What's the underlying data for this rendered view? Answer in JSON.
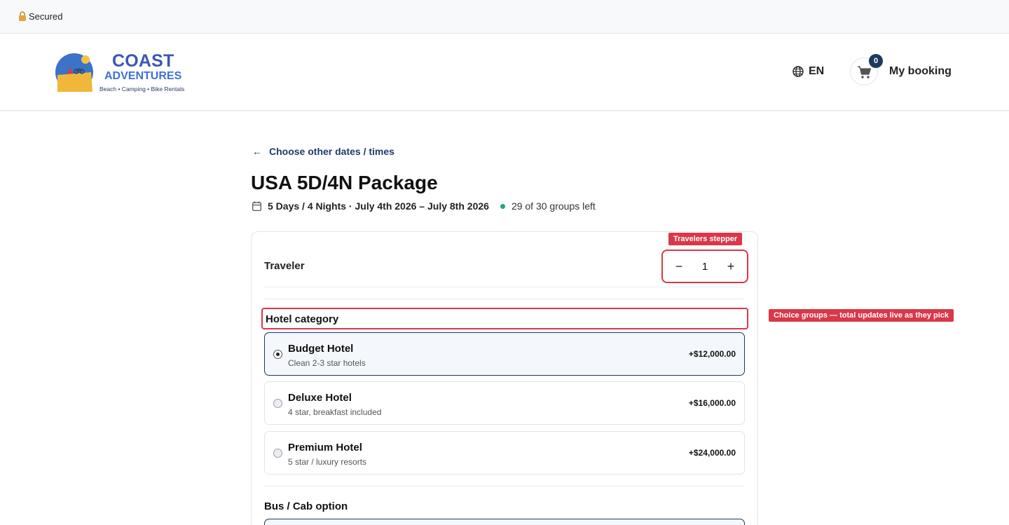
{
  "secure_bar": {
    "text": "Secured"
  },
  "brand": {
    "title": "COAST",
    "subtitle": "ADVENTURES",
    "tagline": "Beach • Camping • Bike Rentals"
  },
  "header": {
    "language": "EN",
    "cart_count": "0",
    "booking_label": "My booking"
  },
  "nav": {
    "back_label": "Choose other dates / times"
  },
  "package": {
    "title": "USA 5D/4N Package",
    "dates": "5 Days / 4 Nights · July 4th 2026 – July 8th 2026",
    "availability": "29 of 30 groups left"
  },
  "traveler": {
    "label": "Traveler",
    "quantity": "1",
    "minus": "−",
    "plus": "+"
  },
  "hotel": {
    "heading": "Hotel category",
    "options": [
      {
        "name": "Budget Hotel",
        "description": "Clean 2-3 star hotels",
        "price": "+$12,000.00",
        "selected": true
      },
      {
        "name": "Deluxe Hotel",
        "description": "4 star, breakfast included",
        "price": "+$16,000.00",
        "selected": false
      },
      {
        "name": "Premium Hotel",
        "description": "5 star / luxury resorts",
        "price": "+$24,000.00",
        "selected": false
      }
    ]
  },
  "bus": {
    "heading": "Bus / Cab option"
  },
  "annotations": {
    "stepper": "Travelers stepper",
    "choice_groups": "Choice groups — total updates live as they pick"
  },
  "colors": {
    "accent_navy": "#1e3a5f",
    "annotation_red": "#d93848",
    "availability_green": "#1fa971",
    "brand_blue": "#3a57b3"
  }
}
